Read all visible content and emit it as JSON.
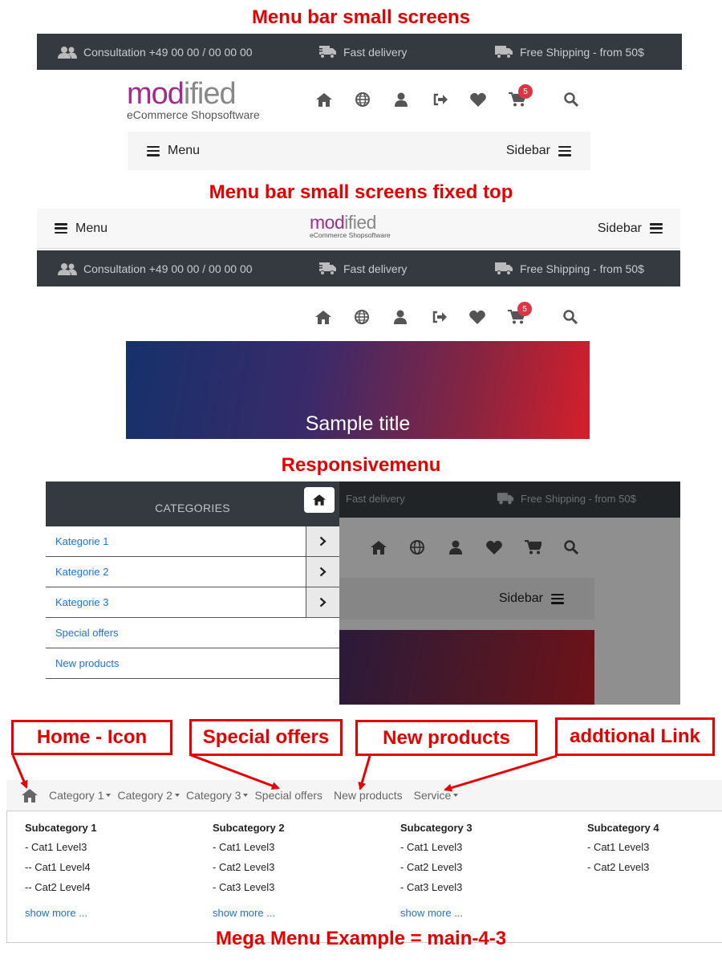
{
  "headings": {
    "small": "Menu bar small screens",
    "fixed": "Menu bar small screens fixed top",
    "responsive": "Responsivemenu",
    "mega": "Mega Menu Example = main-4-3"
  },
  "topbar": {
    "consultation": "Consultation +49 00 00 / 00 00 00",
    "fast_delivery": "Fast delivery",
    "free_shipping": "Free Shipping - from 50$"
  },
  "logo": {
    "word_part1": "mod",
    "word_part2": "ified",
    "sub": "eCommerce Shopsoftware"
  },
  "icons": [
    "home-icon",
    "globe-icon",
    "user-icon",
    "logout-icon",
    "heart-icon",
    "cart-icon",
    "search-icon"
  ],
  "cart_count": "5",
  "menubar": {
    "menu_label": "Menu",
    "sidebar_label": "Sidebar"
  },
  "banner": {
    "title": "Sample title",
    "colors": {
      "start": "#15316b",
      "end": "#d61f2a"
    }
  },
  "responsive": {
    "panel_title": "CATEGORIES",
    "items": [
      {
        "label": "Kategorie 1",
        "has_sub": true
      },
      {
        "label": "Kategorie 2",
        "has_sub": true
      },
      {
        "label": "Kategorie 3",
        "has_sub": true
      },
      {
        "label": "Special offers",
        "has_sub": false
      },
      {
        "label": "New products",
        "has_sub": false
      }
    ]
  },
  "callouts": {
    "home": "Home - Icon",
    "special": "Special offers",
    "new": "New products",
    "additional": "addtional Link"
  },
  "mega_nav": {
    "items": [
      {
        "label": "Category 1",
        "dropdown": true
      },
      {
        "label": "Category 2",
        "dropdown": true
      },
      {
        "label": "Category 3",
        "dropdown": true
      },
      {
        "label": "Special offers",
        "dropdown": false
      },
      {
        "label": "New products",
        "dropdown": false
      },
      {
        "label": "Service",
        "dropdown": true
      }
    ]
  },
  "mega_columns": [
    {
      "title": "Subcategory 1",
      "entries": [
        "- Cat1 Level3",
        "-- Cat1 Level4",
        "-- Cat2 Level4"
      ],
      "more": "show more ..."
    },
    {
      "title": "Subcategory 2",
      "entries": [
        "- Cat1 Level3",
        "- Cat2 Level3",
        "- Cat3 Level3"
      ],
      "more": "show more ..."
    },
    {
      "title": "Subcategory 3",
      "entries": [
        "- Cat1 Level3",
        "- Cat2 Level3",
        "- Cat3 Level3"
      ],
      "more": "show more ..."
    },
    {
      "title": "Subcategory 4",
      "entries": [
        "- Cat1 Level3",
        "- Cat2 Level3"
      ],
      "more": ""
    }
  ],
  "colors": {
    "accent_red": "#e60000",
    "dark_bar": "#343a40",
    "link_blue": "#1a73e8",
    "badge_red": "#dc3545"
  }
}
